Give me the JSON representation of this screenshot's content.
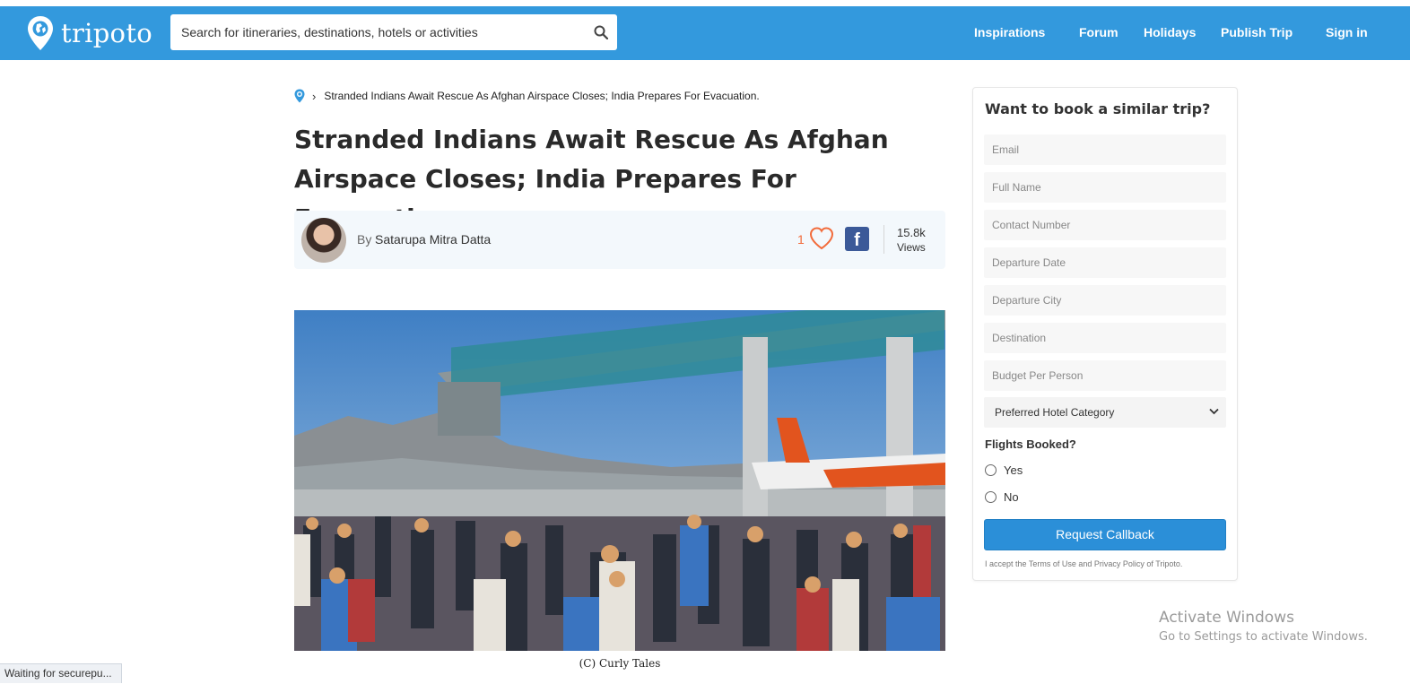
{
  "brand": {
    "name": "tripoto",
    "color": "#3399dd"
  },
  "search": {
    "placeholder": "Search for itineraries, destinations, hotels or activities"
  },
  "nav": {
    "items": [
      "Inspirations",
      "Forum",
      "Holidays",
      "Publish Trip",
      "Sign in"
    ]
  },
  "breadcrumb": {
    "current": "Stranded Indians Await Rescue As Afghan Airspace Closes; India Prepares For Evacuation."
  },
  "article": {
    "title": "Stranded Indians Await Rescue As Afghan Airspace Closes; India Prepares For Evacuation.",
    "by_label": "By",
    "author": "Satarupa Mitra Datta",
    "likes": "1",
    "views_count": "15.8k",
    "views_label": "Views",
    "image_caption": "(C) Curly Tales"
  },
  "form": {
    "title": "Want to book a similar trip?",
    "fields": {
      "email": "Email",
      "full_name": "Full Name",
      "contact": "Contact Number",
      "departure_date": "Departure Date",
      "departure_city": "Departure City",
      "destination": "Destination",
      "budget": "Budget Per Person"
    },
    "hotel_select": "Preferred Hotel Category",
    "flights_label": "Flights Booked?",
    "options": [
      "Yes",
      "No"
    ],
    "submit": "Request Callback",
    "terms": "I accept the Terms of Use and Privacy Policy of Tripoto."
  },
  "watermark": {
    "line1": "Activate Windows",
    "line2": "Go to Settings to activate Windows."
  },
  "status_bar": "Waiting for securepu..."
}
